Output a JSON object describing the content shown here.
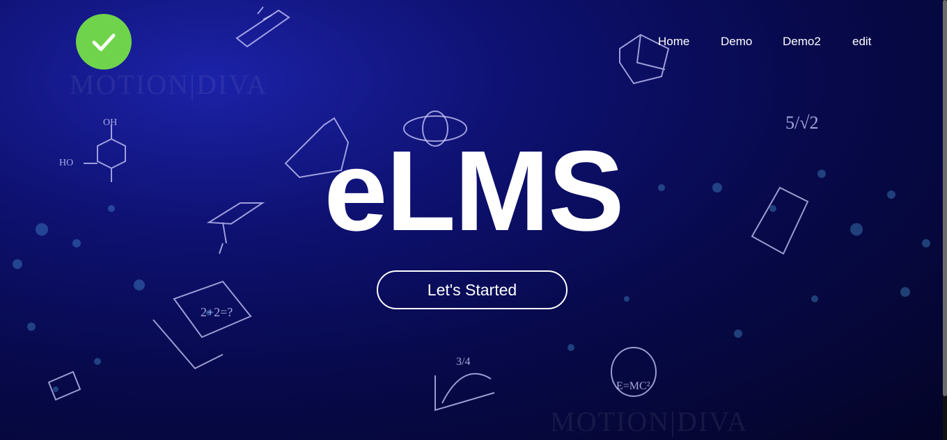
{
  "logo": {
    "icon": "checkmark-icon",
    "color": "#6fd44c"
  },
  "nav": {
    "items": [
      {
        "label": "Home"
      },
      {
        "label": "Demo"
      },
      {
        "label": "Demo2"
      },
      {
        "label": "edit"
      }
    ]
  },
  "hero": {
    "title": "eLMS",
    "cta_label": "Let's Started"
  },
  "background": {
    "watermark": "MOTION|DIVA",
    "doodle_labels": [
      "2+2=?",
      "E=MC²",
      "3/4",
      "HO",
      "OH",
      "5/√2"
    ]
  }
}
